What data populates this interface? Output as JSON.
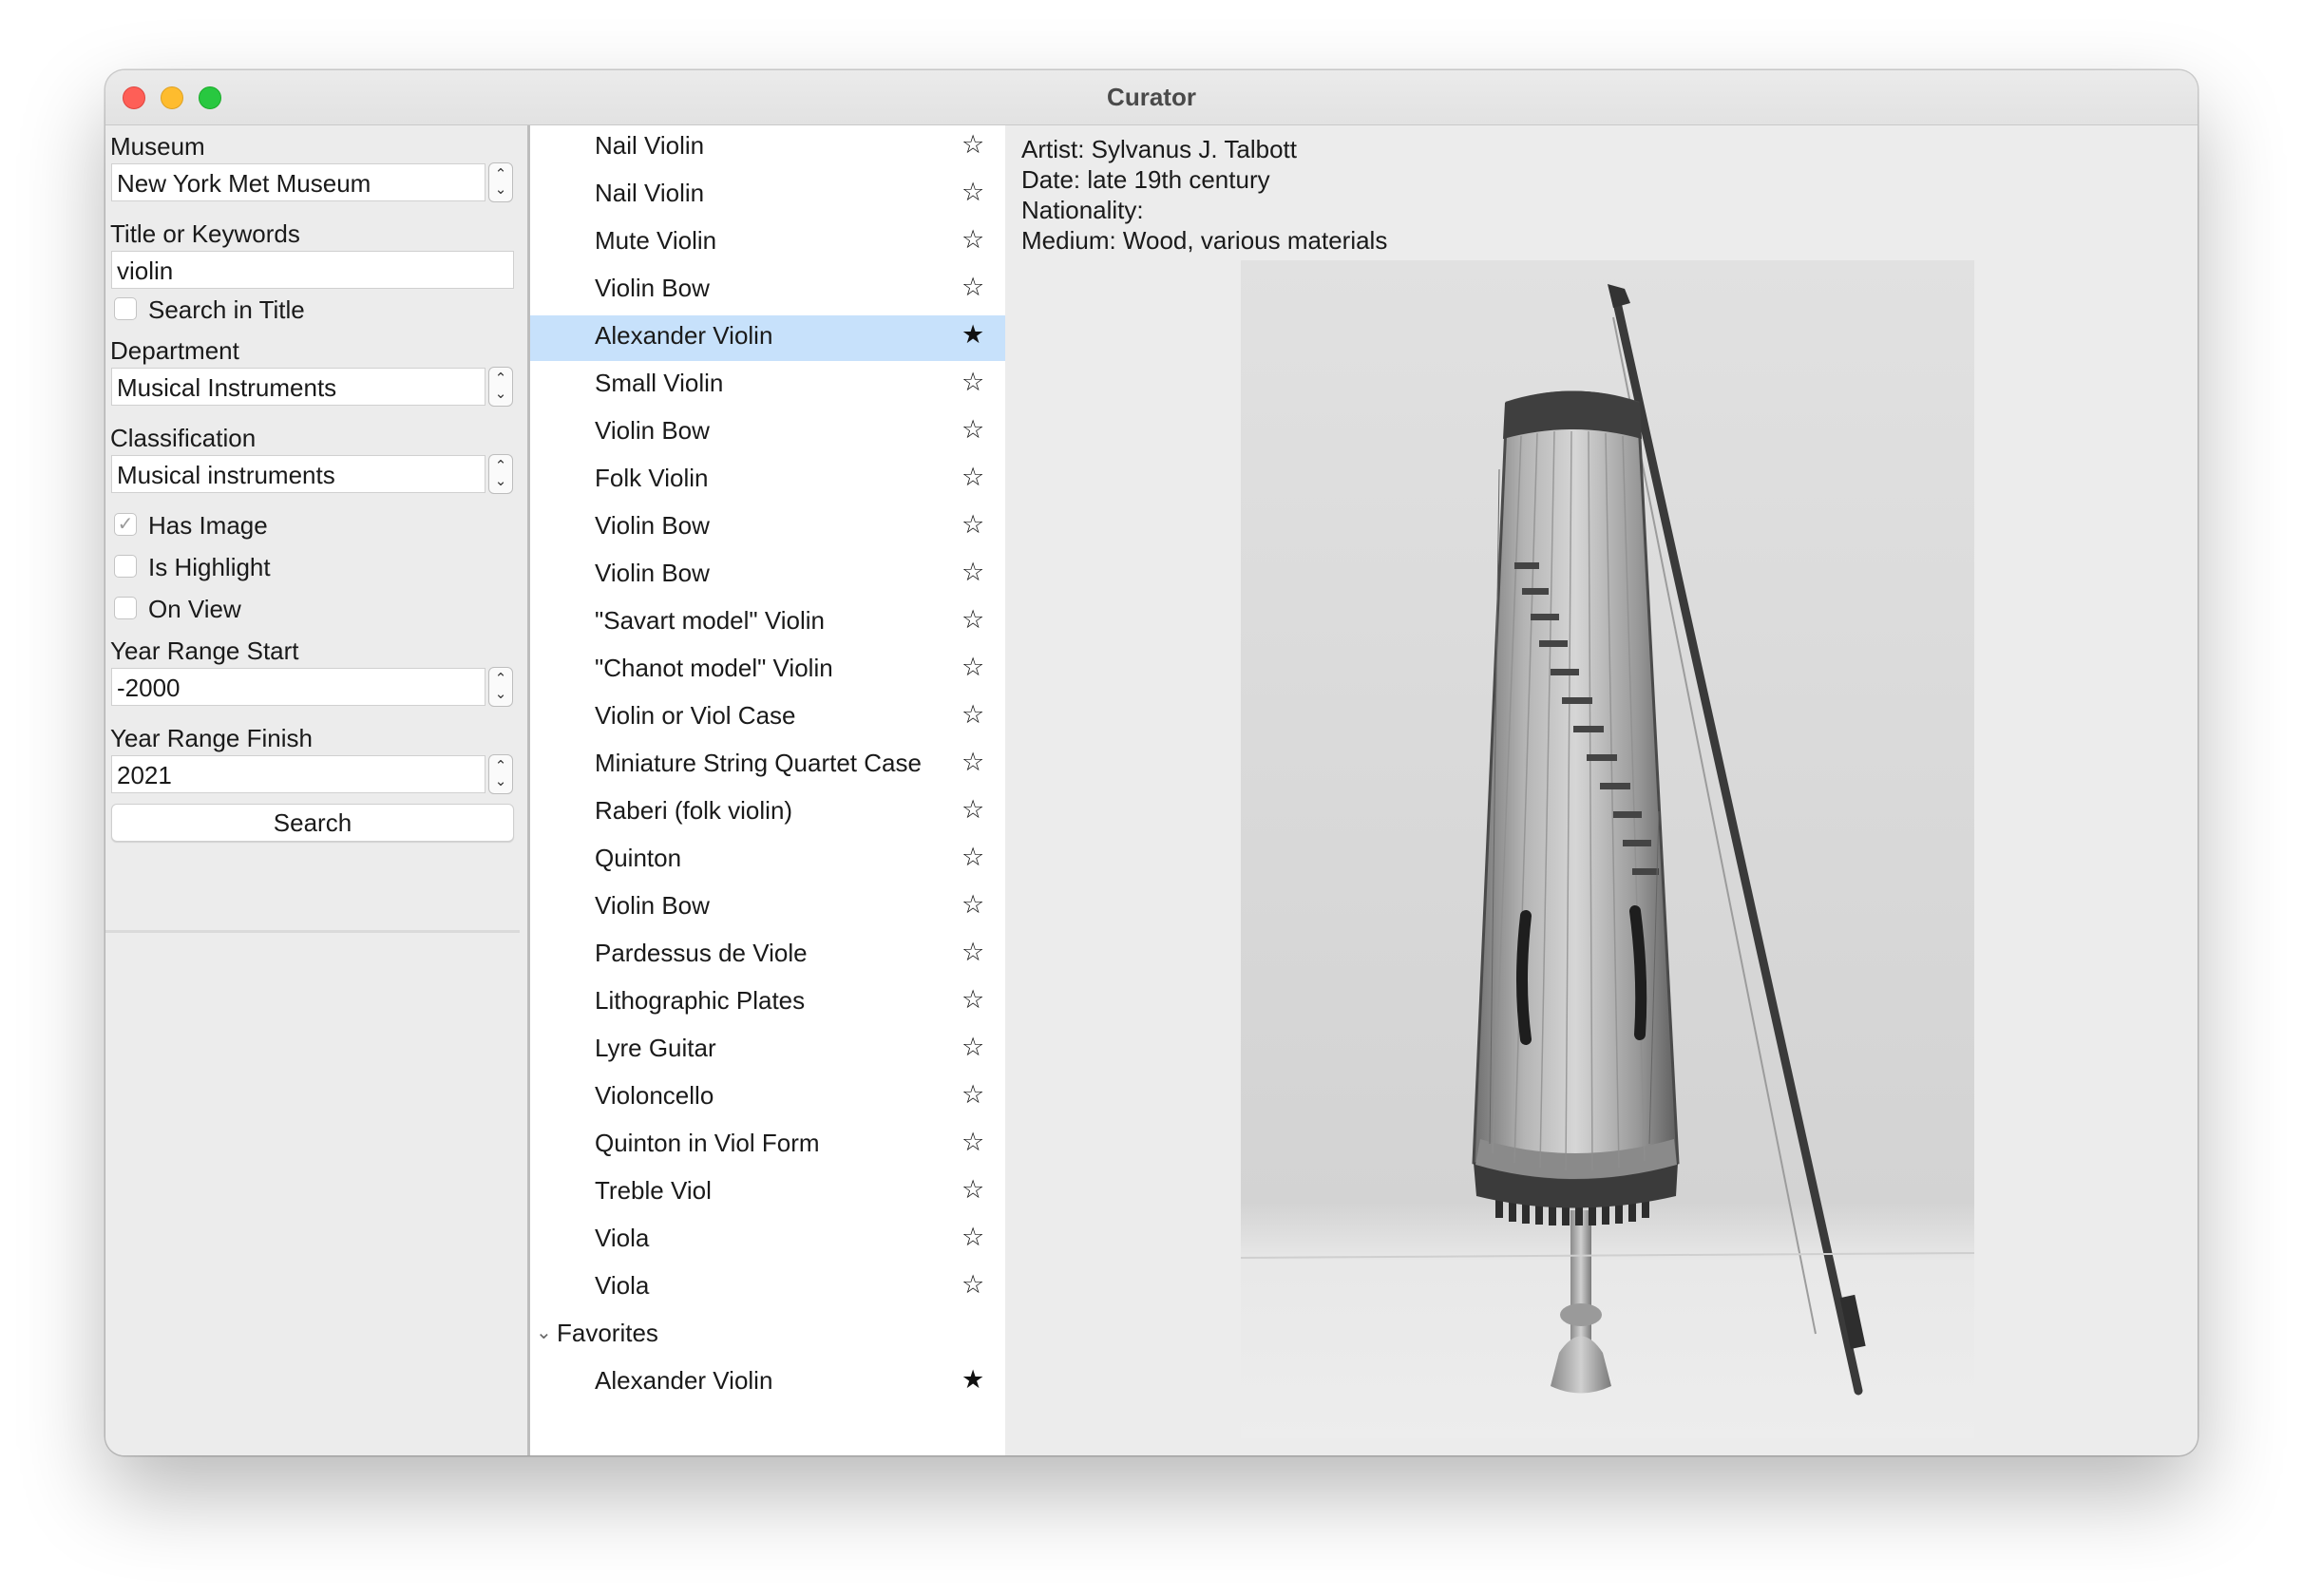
{
  "window": {
    "title": "Curator"
  },
  "filters": {
    "museum_label": "Museum",
    "museum_value": "New York Met Museum",
    "keywords_label": "Title or Keywords",
    "keywords_value": "violin",
    "search_in_title_label": "Search in Title",
    "search_in_title_checked": false,
    "department_label": "Department",
    "department_value": "Musical Instruments",
    "classification_label": "Classification",
    "classification_value": "Musical instruments",
    "has_image_label": "Has Image",
    "has_image_checked": true,
    "is_highlight_label": "Is Highlight",
    "is_highlight_checked": false,
    "on_view_label": "On View",
    "on_view_checked": false,
    "year_start_label": "Year Range Start",
    "year_start_value": "-2000",
    "year_finish_label": "Year Range Finish",
    "year_finish_value": "2021",
    "search_button": "Search"
  },
  "results": {
    "items": [
      {
        "name": "Nail Violin",
        "favorite": false
      },
      {
        "name": "Nail Violin",
        "favorite": false
      },
      {
        "name": "Mute Violin",
        "favorite": false
      },
      {
        "name": "Violin Bow",
        "favorite": false
      },
      {
        "name": "Alexander Violin",
        "favorite": true,
        "selected": true
      },
      {
        "name": "Small Violin",
        "favorite": false
      },
      {
        "name": "Violin Bow",
        "favorite": false
      },
      {
        "name": "Folk Violin",
        "favorite": false
      },
      {
        "name": "Violin Bow",
        "favorite": false
      },
      {
        "name": "Violin Bow",
        "favorite": false
      },
      {
        "name": "\"Savart model\" Violin",
        "favorite": false
      },
      {
        "name": "\"Chanot model\" Violin",
        "favorite": false
      },
      {
        "name": "Violin or Viol Case",
        "favorite": false
      },
      {
        "name": "Miniature String Quartet Case",
        "favorite": false
      },
      {
        "name": "Raberi (folk violin)",
        "favorite": false
      },
      {
        "name": "Quinton",
        "favorite": false
      },
      {
        "name": "Violin Bow",
        "favorite": false
      },
      {
        "name": "Pardessus de Viole",
        "favorite": false
      },
      {
        "name": "Lithographic Plates",
        "favorite": false
      },
      {
        "name": "Lyre Guitar",
        "favorite": false
      },
      {
        "name": "Violoncello",
        "favorite": false
      },
      {
        "name": "Quinton in Viol Form",
        "favorite": false
      },
      {
        "name": "Treble Viol",
        "favorite": false
      },
      {
        "name": "Viola",
        "favorite": false
      },
      {
        "name": "Viola",
        "favorite": false
      }
    ],
    "favorites_group_label": "Favorites",
    "favorites": [
      {
        "name": "Alexander Violin",
        "favorite": true
      }
    ]
  },
  "icons": {
    "star_empty": "☆",
    "star_filled": "★",
    "chevron_down": "⌄",
    "stepper_up": "⌃",
    "stepper_down": "⌄",
    "checkmark": "✓"
  },
  "detail": {
    "artist": "Artist: Sylvanus J. Talbott",
    "date": "Date: late 19th century",
    "nationality": "Nationality:",
    "medium": "Medium: Wood, various materials"
  },
  "colors": {
    "selection": "#c7e1fb",
    "traffic_close": "#fe5f57",
    "traffic_min": "#febc2e",
    "traffic_zoom": "#28c840"
  }
}
